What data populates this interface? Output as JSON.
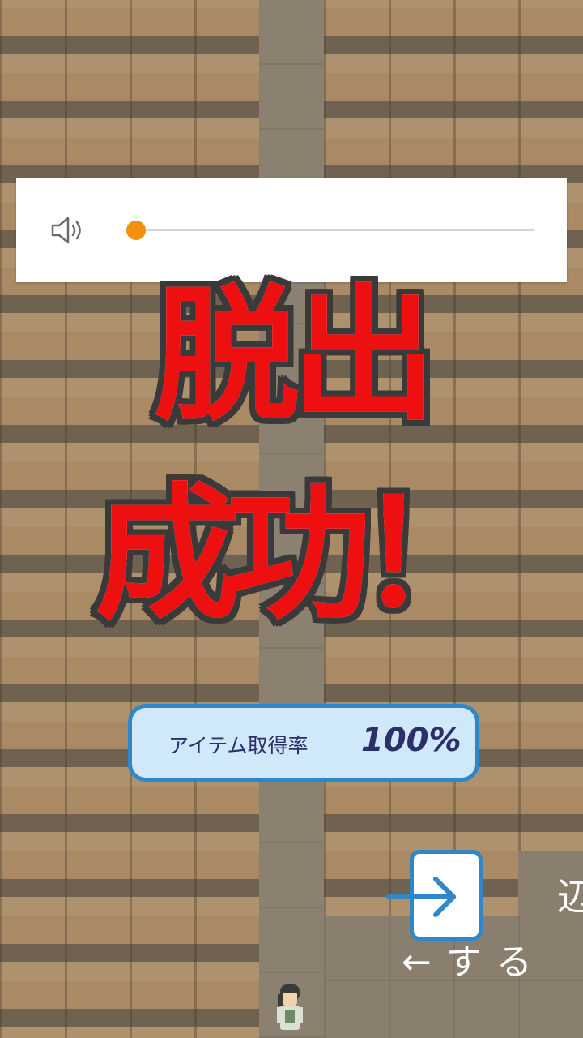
{
  "volume": {
    "icon": "speaker-icon",
    "level": 0.02,
    "accent_color": "#f4900c"
  },
  "title": {
    "line1": "脱出",
    "line2": "成功！",
    "color": "#ee1010"
  },
  "result": {
    "label": "アイテム取得率",
    "value": "100%"
  },
  "exit_button": {
    "icon": "exit-arrow-icon",
    "color": "#2f86c8"
  },
  "side_text": {
    "glyph": "辺",
    "hint": "←する"
  }
}
